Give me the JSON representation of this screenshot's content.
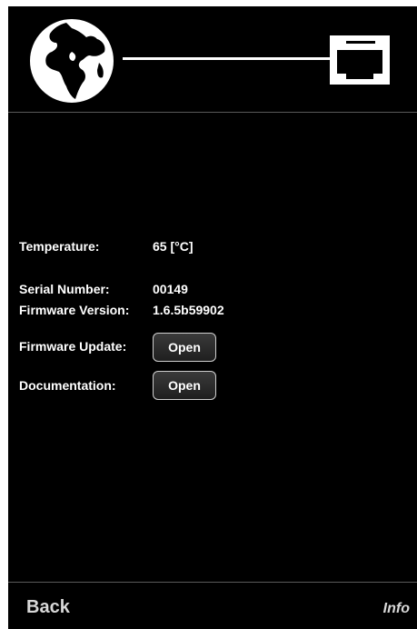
{
  "header": {
    "left_icon": "globe-icon",
    "right_icon": "ethernet-port-icon",
    "connection": "connected"
  },
  "info": {
    "temperature_label": "Temperature:",
    "temperature_value": "65 [°C]",
    "serial_label": "Serial Number:",
    "serial_value": "00149",
    "firmware_label": "Firmware Version:",
    "firmware_value": "1.6.5b59902",
    "firmware_update_label": "Firmware Update:",
    "firmware_update_button": "Open",
    "documentation_label": "Documentation:",
    "documentation_button": "Open"
  },
  "footer": {
    "back_label": "Back",
    "page_label": "Info"
  },
  "colors": {
    "background": "#000000",
    "text": "#ffffff",
    "divider": "#5a5a5a",
    "button_border": "#cfcfcf"
  }
}
